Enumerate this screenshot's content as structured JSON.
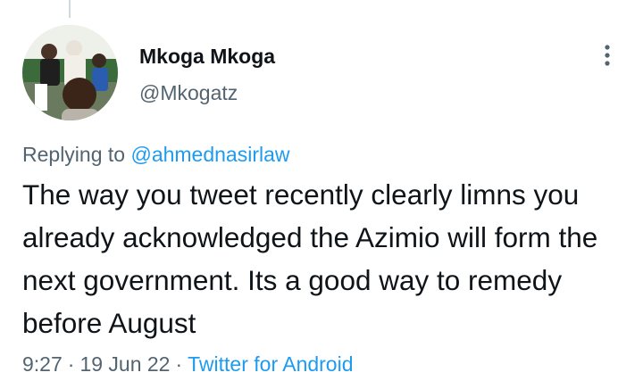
{
  "tweet": {
    "author": {
      "display_name": "Mkoga Mkoga",
      "handle": "@Mkogatz",
      "avatar_icon": "avatar-photo"
    },
    "replying_prefix": "Replying to",
    "replying_to": "@ahmednasirlaw",
    "text": "The way you tweet recently clearly limns you already acknowledged the Azimio will form the next government. Its a good way to remedy before August",
    "time": "9:27",
    "date": "19 Jun 22",
    "separator": "·",
    "source": "Twitter for Android",
    "menu_icon": "more-vertical-icon"
  },
  "colors": {
    "text": "#0f1419",
    "muted": "#536471",
    "link": "#1d9bf0",
    "thread_line": "#cfd9de"
  }
}
